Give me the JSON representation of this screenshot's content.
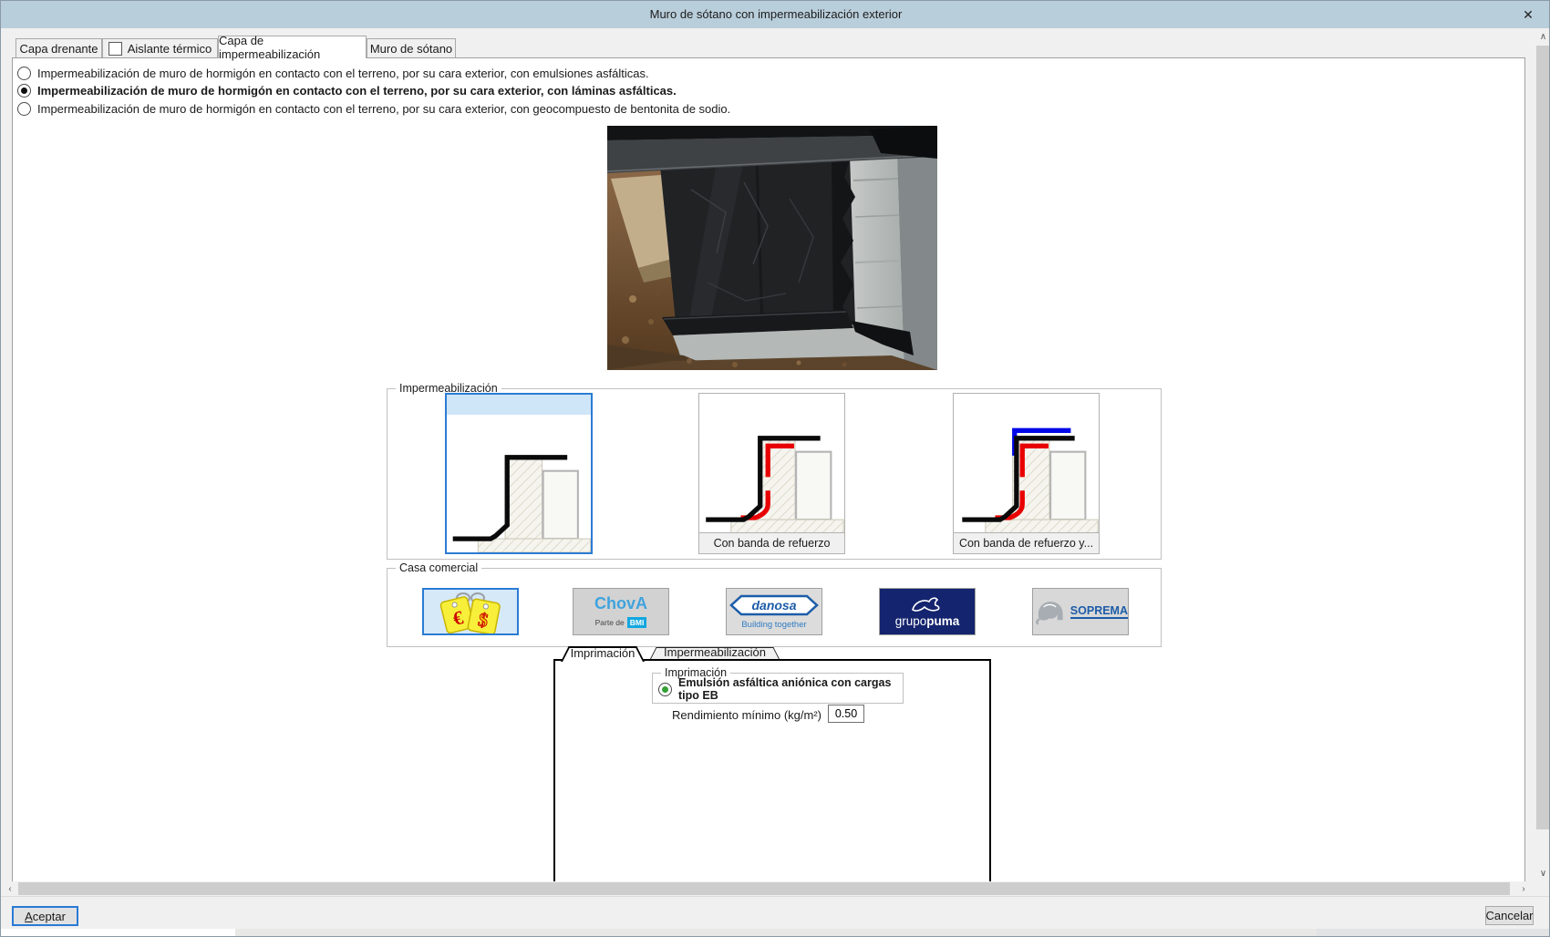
{
  "window": {
    "title": "Muro de sótano con impermeabilización exterior",
    "close": "✕"
  },
  "tabs": {
    "t1": "Capa drenante",
    "t2": "Aislante térmico",
    "t3": "Capa de impermeabilización",
    "t4": "Muro de sótano"
  },
  "options": {
    "o1": "Impermeabilización de muro de hormigón en contacto con el terreno, por su cara exterior, con emulsiones asfálticas.",
    "o2": "Impermeabilización de muro de hormigón en contacto con el terreno, por su cara exterior, con láminas asfálticas.",
    "o3": "Impermeabilización de muro de hormigón en contacto con el terreno, por su cara exterior, con geocompuesto de bentonita de sodio."
  },
  "impermeabilizacion": {
    "title": "Impermeabilización",
    "tile2_caption": "Con banda de refuerzo",
    "tile3_caption": "Con banda de refuerzo y..."
  },
  "casa_comercial": {
    "title": "Casa comercial",
    "brands": {
      "generic_euro": "€",
      "generic_dollar": "$",
      "chova": "ChovA",
      "chova_sub": "Parte de",
      "chova_bmi": "BMI",
      "danosa": "danosa",
      "danosa_sub": "Building together",
      "grupopuma_light": "grupo",
      "grupopuma_bold": "puma",
      "soprema": "SOPREMA"
    }
  },
  "subtabs": {
    "t1": "Imprimación",
    "t2": "Impermeabilización"
  },
  "imprimacion": {
    "group_title": "Imprimación",
    "option": "Emulsión asfáltica aniónica con cargas tipo EB",
    "rendimiento_label": "Rendimiento mínimo (kg/m²)",
    "rendimiento_value": "0.50"
  },
  "buttons": {
    "accept": "Aceptar",
    "cancel": "Cancelar"
  },
  "scrollbar": {
    "up": "∧",
    "down": "∨",
    "left": "‹",
    "right": "›"
  },
  "colors": {
    "accent": "#2b7cd3",
    "selection_bg": "#cfe5f8",
    "diagram_red": "#e80000",
    "diagram_blue": "#0008e8"
  }
}
